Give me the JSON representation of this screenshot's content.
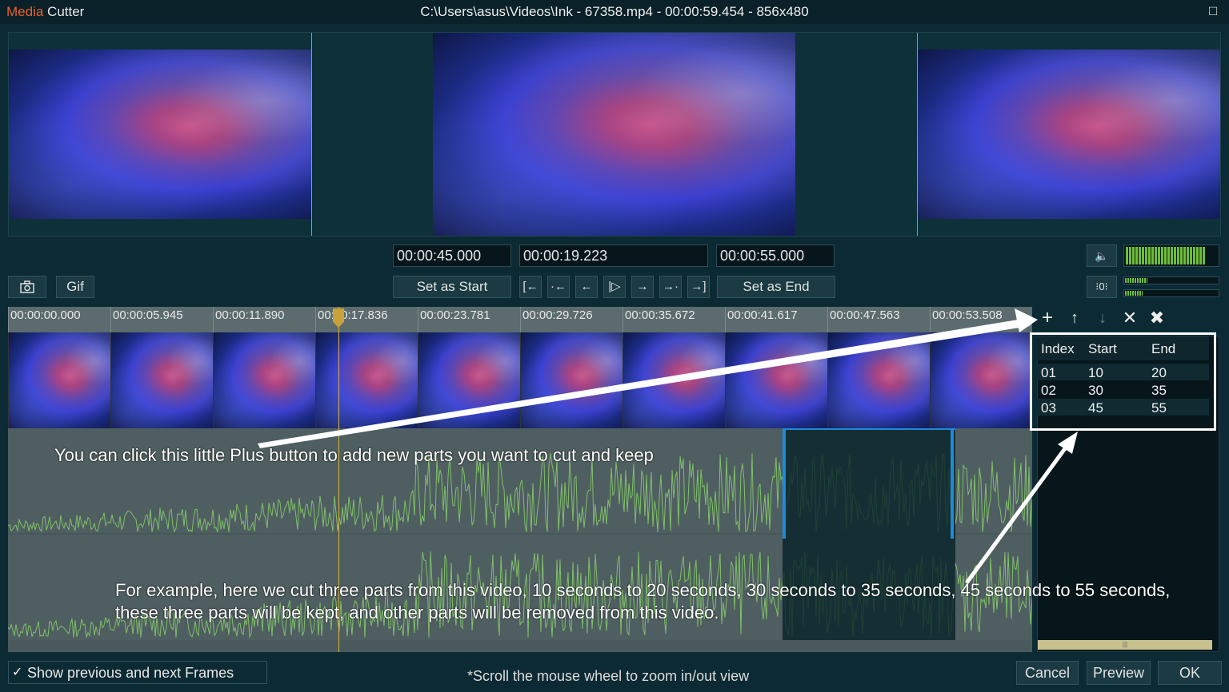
{
  "window": {
    "brand": "Media",
    "app": " Cutter",
    "title": "C:\\Users\\asus\\Videos\\Ink - 67358.mp4 - 00:00:59.454 - 856x480"
  },
  "controls": {
    "start_time": "00:00:45.000",
    "current_time": "00:00:19.223",
    "end_time": "00:00:55.000",
    "set_start": "Set as Start",
    "set_end": "Set as End",
    "gif": "Gif",
    "nav": [
      "[←",
      "·←",
      "←",
      "|▷",
      "→",
      "→·",
      "→]"
    ],
    "volume_level": 0.85
  },
  "timeline": {
    "ticks": [
      "00:00:00.000",
      "00:00:05.945",
      "00:00:11.890",
      "00:00:17.836",
      "00:00:23.781",
      "00:00:29.726",
      "00:00:35.672",
      "00:00:41.617",
      "00:00:47.563",
      "00:00:53.508"
    ]
  },
  "parts": {
    "headers": [
      "Index",
      "Start",
      "End"
    ],
    "rows": [
      {
        "index": "01",
        "start": "10",
        "end": "20"
      },
      {
        "index": "02",
        "start": "30",
        "end": "35"
      },
      {
        "index": "03",
        "start": "45",
        "end": "55"
      }
    ]
  },
  "annotations": {
    "plus_hint": "You can click this little Plus button to add new parts you want to cut and keep",
    "example_line1": "For example, here we cut three parts from this video, 10 seconds to 20 seconds, 30 seconds to 35 seconds, 45 seconds to 55 seconds,",
    "example_line2": "these three parts will be kept, and other parts will be removed from this video."
  },
  "footer": {
    "show_frames": "Show previous and next Frames",
    "hint": "*Scroll the mouse wheel to zoom in/out view",
    "cancel": "Cancel",
    "preview": "Preview",
    "ok": "OK"
  }
}
